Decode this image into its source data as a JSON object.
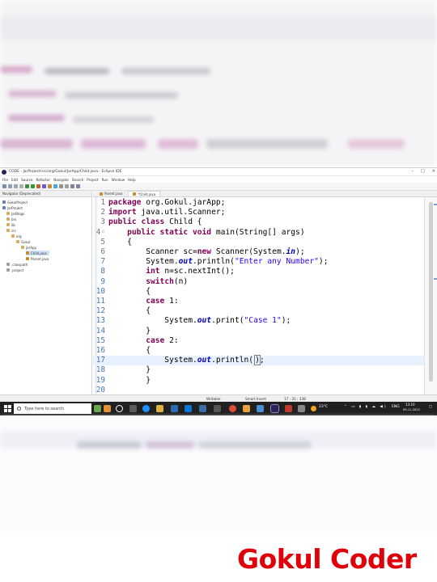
{
  "window": {
    "title": "CODE - JarProject/src/org/Gokul/JarApp/Child.java - Eclipse IDE",
    "controls": [
      "–",
      "□",
      "✕"
    ]
  },
  "menu": [
    "File",
    "Edit",
    "Source",
    "Refactor",
    "Navigate",
    "Search",
    "Project",
    "Run",
    "Window",
    "Help"
  ],
  "explorer": {
    "header": "Navigator (Deprecated)",
    "items": [
      {
        "label": "GokulProject",
        "indent": 0
      },
      {
        "label": "JarProject",
        "indent": 0
      },
      {
        "label": "JarBlogs",
        "indent": 1
      },
      {
        "label": "bin",
        "indent": 1
      },
      {
        "label": "lib",
        "indent": 1
      },
      {
        "label": "src",
        "indent": 1
      },
      {
        "label": "org",
        "indent": 2
      },
      {
        "label": "Gokul",
        "indent": 3
      },
      {
        "label": "JarApp",
        "indent": 4
      },
      {
        "label": "Child.java",
        "indent": 5,
        "selected": true
      },
      {
        "label": "Parent.java",
        "indent": 5
      },
      {
        "label": ".classpath",
        "indent": 1
      },
      {
        "label": ".project",
        "indent": 1
      }
    ]
  },
  "editor": {
    "tabs": [
      {
        "label": "Parent.java",
        "active": false
      },
      {
        "label": "*Child.java",
        "active": true
      }
    ],
    "lines": [
      {
        "n": "1",
        "code": [
          {
            "t": "package",
            "c": "kw"
          },
          {
            "t": " org.Gokul.jarApp;"
          }
        ]
      },
      {
        "n": "2",
        "code": [
          {
            "t": "import",
            "c": "kw"
          },
          {
            "t": " java.util.Scanner;"
          }
        ]
      },
      {
        "n": "3",
        "code": [
          {
            "t": "public",
            "c": "kw"
          },
          {
            "t": " "
          },
          {
            "t": "class",
            "c": "kw"
          },
          {
            "t": " Child {"
          }
        ]
      },
      {
        "n": "4◦",
        "code": [
          {
            "t": "    "
          },
          {
            "t": "public",
            "c": "kw"
          },
          {
            "t": " "
          },
          {
            "t": "static",
            "c": "kw"
          },
          {
            "t": " "
          },
          {
            "t": "void",
            "c": "kw"
          },
          {
            "t": " main(String[] args)"
          }
        ]
      },
      {
        "n": "5",
        "code": [
          {
            "t": "    {"
          }
        ]
      },
      {
        "n": "6",
        "code": [
          {
            "t": "        Scanner sc="
          },
          {
            "t": "new",
            "c": "kw"
          },
          {
            "t": " Scanner(System."
          },
          {
            "t": "in",
            "c": "fld"
          },
          {
            "t": ");"
          }
        ]
      },
      {
        "n": "7",
        "blue": true,
        "code": [
          {
            "t": "        System."
          },
          {
            "t": "out",
            "c": "fld"
          },
          {
            "t": ".println("
          },
          {
            "t": "\"Enter any Number\"",
            "c": "str"
          },
          {
            "t": ");"
          }
        ]
      },
      {
        "n": "8",
        "blue": true,
        "code": [
          {
            "t": "        "
          },
          {
            "t": "int",
            "c": "kw"
          },
          {
            "t": " n=sc.nextInt();"
          }
        ]
      },
      {
        "n": "9",
        "blue": true,
        "code": [
          {
            "t": "        "
          },
          {
            "t": "switch",
            "c": "kw"
          },
          {
            "t": "(n)"
          }
        ]
      },
      {
        "n": "10",
        "blue": true,
        "code": [
          {
            "t": "        {"
          }
        ]
      },
      {
        "n": "11",
        "blue": true,
        "code": [
          {
            "t": "        "
          },
          {
            "t": "case",
            "c": "kw"
          },
          {
            "t": " 1:"
          }
        ]
      },
      {
        "n": "12",
        "blue": true,
        "code": [
          {
            "t": "        {"
          }
        ]
      },
      {
        "n": "13",
        "blue": true,
        "code": [
          {
            "t": "            System."
          },
          {
            "t": "out",
            "c": "fld"
          },
          {
            "t": ".print("
          },
          {
            "t": "\"Case 1\"",
            "c": "str"
          },
          {
            "t": ");"
          }
        ]
      },
      {
        "n": "14",
        "blue": true,
        "code": [
          {
            "t": "        }"
          }
        ]
      },
      {
        "n": "15",
        "blue": true,
        "code": [
          {
            "t": "        "
          },
          {
            "t": "case",
            "c": "kw"
          },
          {
            "t": " 2:"
          }
        ]
      },
      {
        "n": "16",
        "blue": true,
        "code": [
          {
            "t": "        {"
          }
        ]
      },
      {
        "n": "17",
        "blue": true,
        "highlight": true,
        "code": [
          {
            "t": "            System."
          },
          {
            "t": "out",
            "c": "fld"
          },
          {
            "t": ".println("
          },
          {
            "t": ")",
            "c": "box"
          },
          {
            "t": ";"
          }
        ]
      },
      {
        "n": "18",
        "blue": true,
        "code": [
          {
            "t": "        }"
          }
        ]
      },
      {
        "n": "19",
        "blue": true,
        "code": [
          {
            "t": "        }"
          }
        ]
      },
      {
        "n": "20",
        "blue": true,
        "code": []
      }
    ]
  },
  "status": {
    "mode": "Writable",
    "insert": "Smart Insert",
    "position": "17 : 31 : 338"
  },
  "taskbar": {
    "search_placeholder": "Type here to search",
    "weather": "23°C",
    "language": "ENG",
    "time": "13:10",
    "date": "09-11-2022"
  },
  "watermark": "Gokul Coder"
}
